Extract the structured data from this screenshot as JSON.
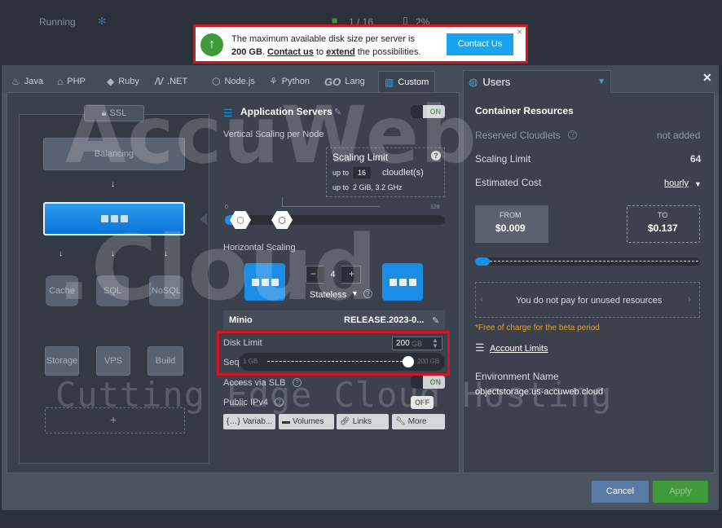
{
  "background": {
    "status": "Running",
    "counter": "1 / 16",
    "percent": "2%"
  },
  "notification": {
    "text_pre": "The maximum available disk size per server is",
    "size": "200 GB",
    "dot": ".",
    "link1": "Contact us",
    "mid": "to",
    "link2": "extend",
    "post": "the possibilities.",
    "button": "Contact Us",
    "close": "×"
  },
  "tabs": [
    {
      "label": "Java"
    },
    {
      "label": "PHP"
    },
    {
      "label": "Ruby"
    },
    {
      "label": ".NET"
    },
    {
      "label": "Node.js"
    },
    {
      "label": "Python"
    },
    {
      "label": "Lang"
    },
    {
      "label": "Custom"
    }
  ],
  "go_logo": "GO",
  "topology": {
    "ssl": "SSL",
    "balancing": "Balancing",
    "cache": "Cache",
    "sql": "SQL",
    "nosql": "NoSQL",
    "storage": "Storage",
    "vps": "VPS",
    "build": "Build"
  },
  "config": {
    "title": "Application Servers",
    "toggle": "ON",
    "vertical_label": "Vertical Scaling per Node",
    "scaling_limit_title": "Scaling Limit",
    "help": "?",
    "up_to": "up to",
    "cloudlets_value": "16",
    "cloudlets_unit": "cloudlet(s)",
    "up_to2": "up to",
    "resources": "2 GiB, 3.2 GHz",
    "slider_min": "0",
    "slider_max": "128",
    "horizontal_label": "Horizontal Scaling",
    "minus": "−",
    "count": "4",
    "plus": "+",
    "stateless": "Stateless",
    "app_name": "Minio",
    "app_tag": "RELEASE.2023-0...",
    "disk_label": "Disk Limit",
    "disk_value": "200",
    "disk_unit": "GB",
    "seq_label": "Seq",
    "disk_min": "1 GB",
    "disk_max": "200 GB",
    "slb_label": "Access via SLB",
    "slb_toggle": "ON",
    "ipv4_label": "Public IPv4",
    "ipv4_toggle": "OFF",
    "buttons": [
      "Variab...",
      "Volumes",
      "Links",
      "More"
    ]
  },
  "right": {
    "tab": "Users",
    "section": "Container Resources",
    "reserved_label": "Reserved Cloudlets",
    "reserved_value": "not added",
    "scaling_label": "Scaling Limit",
    "scaling_value": "64",
    "cost_label": "Estimated Cost",
    "cost_period": "hourly",
    "from_label": "FROM",
    "from_value": "$0.009",
    "to_label": "TO",
    "to_value": "$0.137",
    "unused_text": "You do not pay for unused resources",
    "beta_note": "*Free of charge for the beta period",
    "account_limits": "Account Limits",
    "env_label": "Environment Name",
    "env_value": "objectstorage.us-accuweb.cloud"
  },
  "footer": {
    "cancel": "Cancel",
    "apply": "Apply"
  },
  "watermark": {
    "line1": "AccuWeb",
    "line2": ".Cloud",
    "line3": "Cutting Edge Cloud Hosting"
  },
  "colors": {
    "accent": "#1a8de8",
    "danger": "#d9121f",
    "success": "#3f9b3a",
    "cancel": "#5a7aa6"
  }
}
